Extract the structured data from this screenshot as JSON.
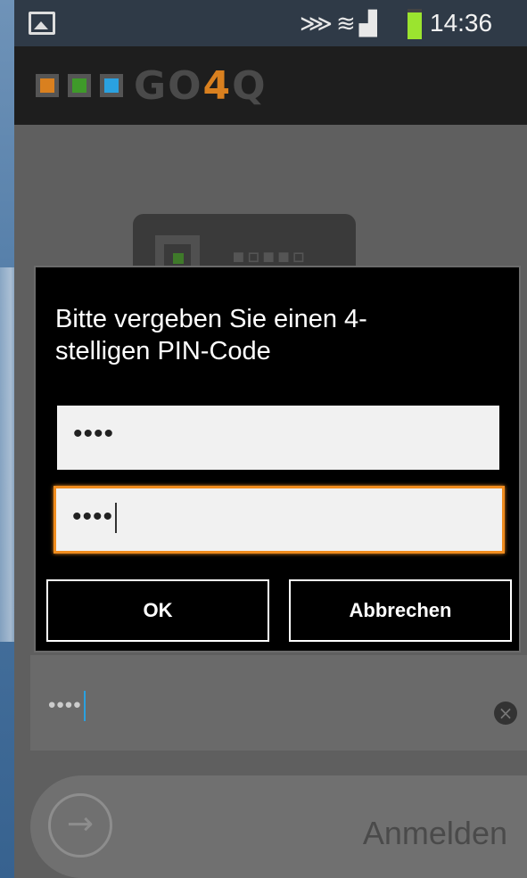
{
  "status_bar": {
    "icons": [
      "image-icon",
      "vibrate-icon",
      "wifi-icon",
      "signal-icon",
      "battery-icon"
    ],
    "time": "14:36"
  },
  "app_bar": {
    "logo_prefix": "GO",
    "logo_four": "4",
    "logo_suffix": "Q",
    "logo_square_colors": [
      "#d9801f",
      "#3f9a2a",
      "#2aa1e0"
    ]
  },
  "dialog": {
    "title": "Bitte vergeben Sie einen 4-stelligen PIN-Code",
    "title_line1": "Bitte vergeben Sie einen 4-",
    "title_line2": "stelligen PIN-Code",
    "pin_value_1": "••••",
    "pin_value_2": "••••",
    "ok_label": "OK",
    "cancel_label": "Abbrechen"
  },
  "background_form": {
    "pin_value": "••••",
    "login_label": "Anmelden"
  },
  "colors": {
    "accent_focus": "#f08c1e",
    "cursor_blue": "#2aa1e0"
  }
}
